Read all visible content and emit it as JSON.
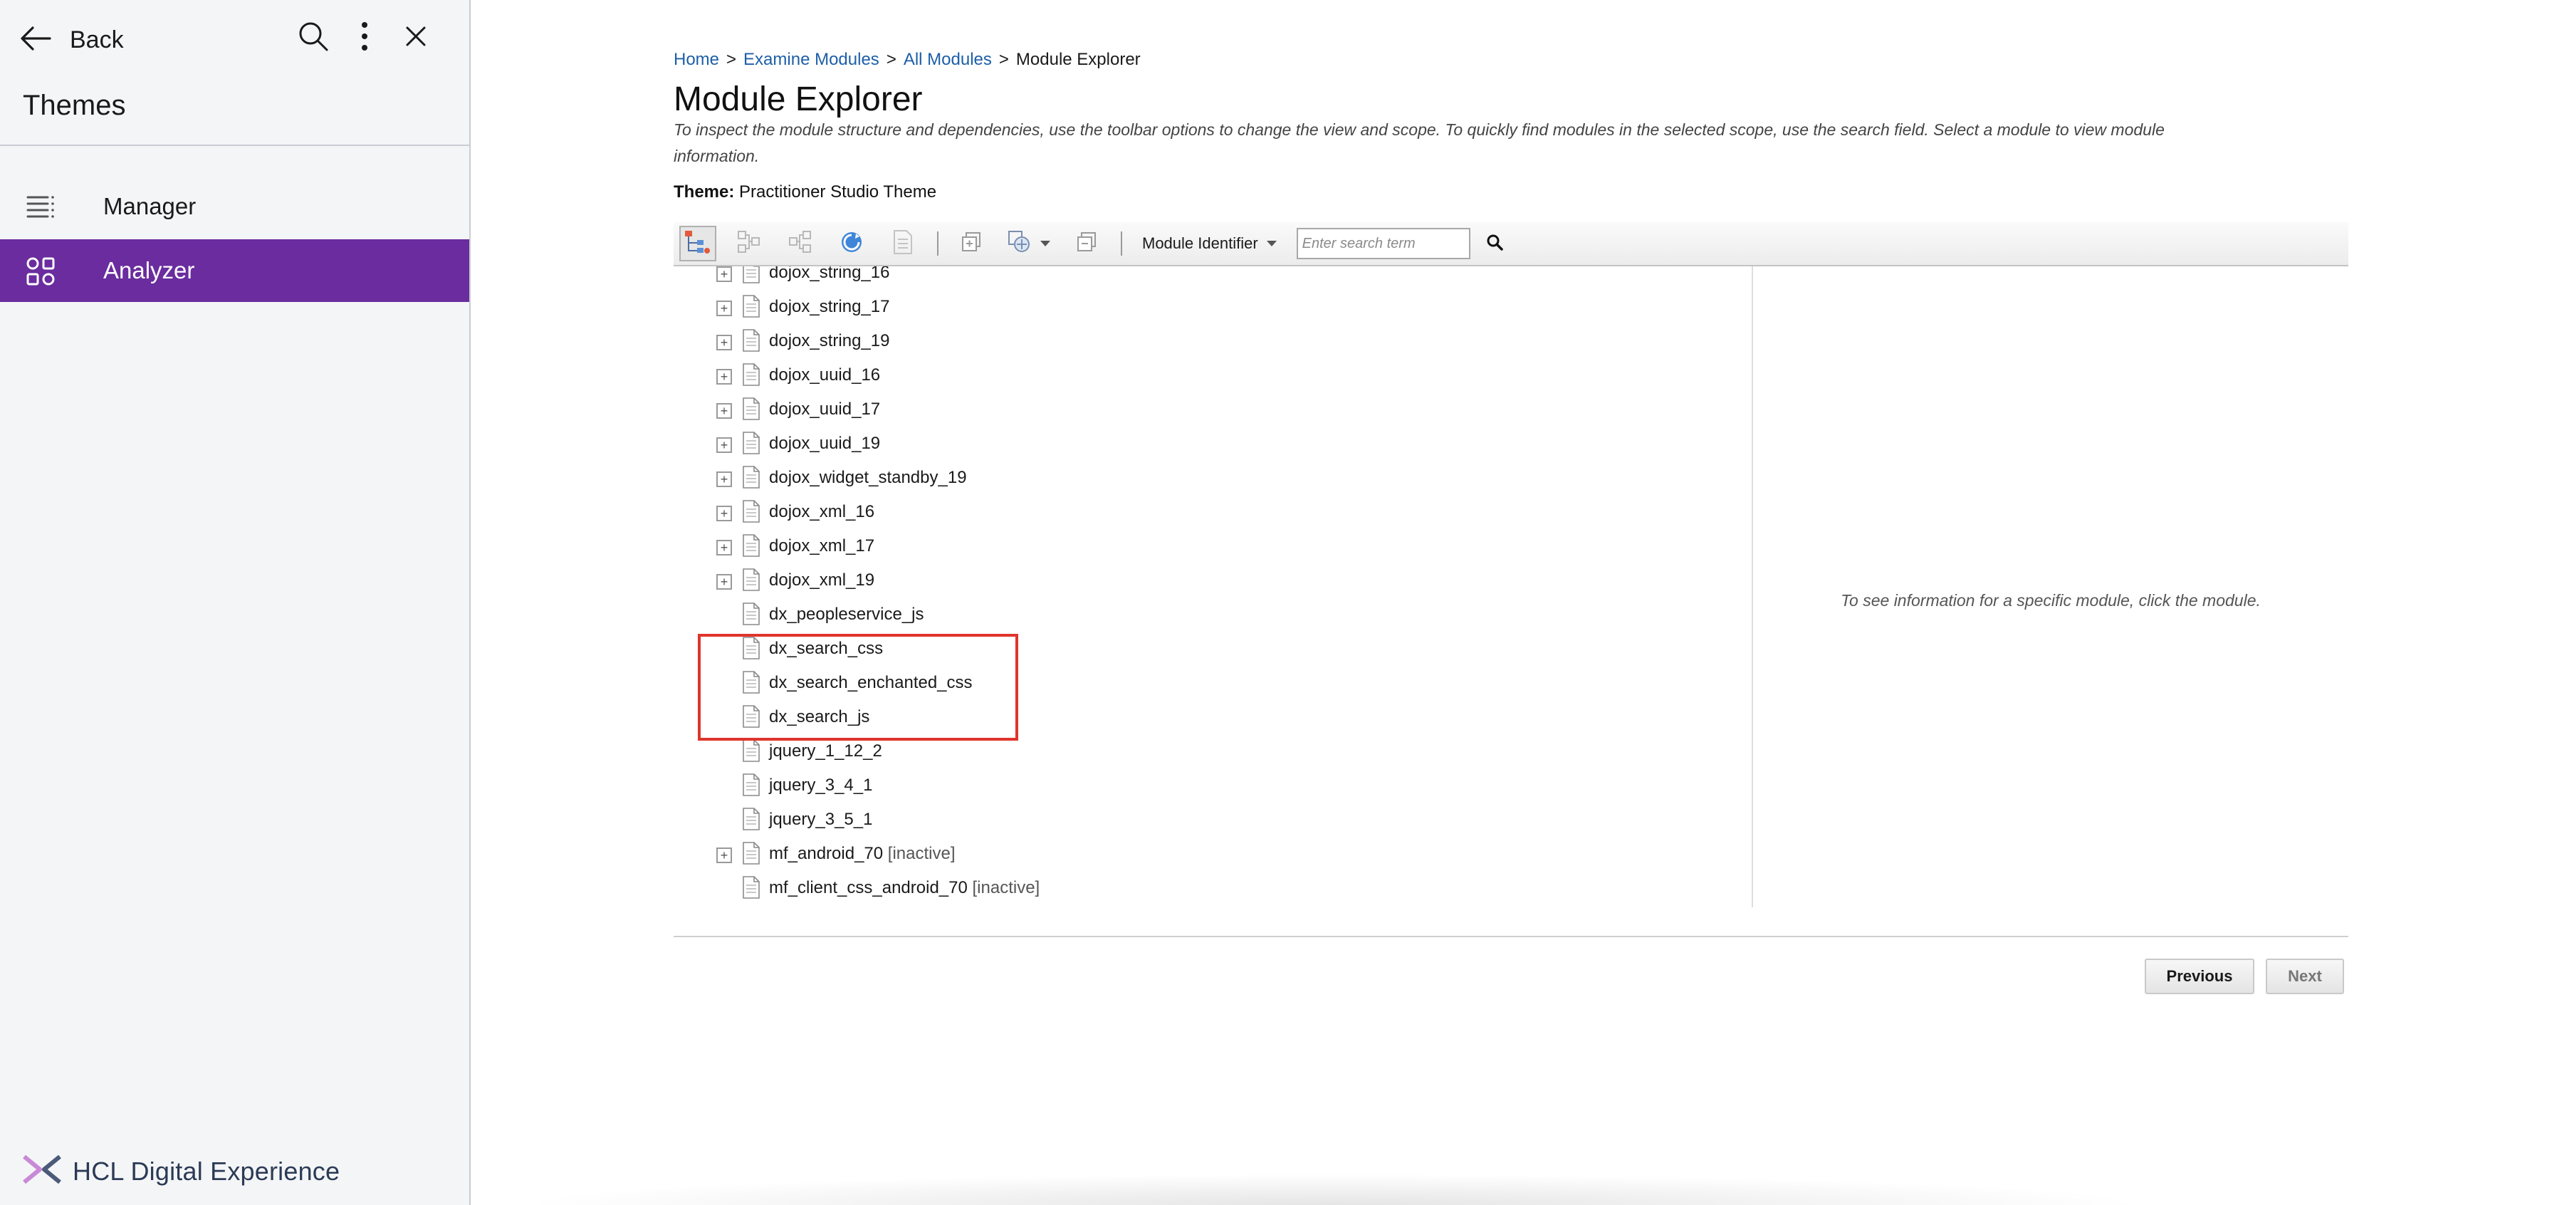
{
  "sidebar": {
    "back_label": "Back",
    "title": "Themes",
    "actions": [
      "search-icon",
      "more-vertical-icon",
      "close-icon"
    ],
    "items": [
      {
        "label": "Manager",
        "icon": "list-icon",
        "selected": false
      },
      {
        "label": "Analyzer",
        "icon": "modules-icon",
        "selected": true
      }
    ],
    "brand": "HCL Digital Experience",
    "selected_color": "#6a2c9e"
  },
  "main": {
    "breadcrumb": {
      "home": "Home",
      "examine": "Examine Modules",
      "all": "All Modules",
      "current": "Module Explorer",
      "separator": ">"
    },
    "title": "Module Explorer",
    "description": "To inspect the module structure and dependencies, use the toolbar options to change the view and scope. To quickly find modules in the selected scope, use the search field. Select a module to view module information.",
    "theme_label": "Theme:",
    "theme_value": "Practitioner Studio Theme",
    "toolbar": {
      "dropdown_label": "Module Identifier",
      "search_placeholder": "Enter search term"
    },
    "tree": [
      {
        "label": "dojox_string_16",
        "expandable": true
      },
      {
        "label": "dojox_string_17",
        "expandable": true
      },
      {
        "label": "dojox_string_19",
        "expandable": true
      },
      {
        "label": "dojox_uuid_16",
        "expandable": true
      },
      {
        "label": "dojox_uuid_17",
        "expandable": true
      },
      {
        "label": "dojox_uuid_19",
        "expandable": true
      },
      {
        "label": "dojox_widget_standby_19",
        "expandable": true
      },
      {
        "label": "dojox_xml_16",
        "expandable": true
      },
      {
        "label": "dojox_xml_17",
        "expandable": true
      },
      {
        "label": "dojox_xml_19",
        "expandable": true
      },
      {
        "label": "dx_peopleservice_js",
        "expandable": false
      },
      {
        "label": "dx_search_css",
        "expandable": false
      },
      {
        "label": "dx_search_enchanted_css",
        "expandable": false
      },
      {
        "label": "dx_search_js",
        "expandable": false
      },
      {
        "label": "jquery_1_12_2",
        "expandable": false
      },
      {
        "label": "jquery_3_4_1",
        "expandable": false
      },
      {
        "label": "jquery_3_5_1",
        "expandable": false
      },
      {
        "label": "mf_android_70",
        "status": "[inactive]",
        "expandable": true
      },
      {
        "label": "mf_client_css_android_70",
        "status": "[inactive]",
        "expandable": false
      }
    ],
    "info_message": "To see information for a specific module, click the module.",
    "pager": {
      "previous": "Previous",
      "next": "Next"
    },
    "highlight_color": "#e0342c"
  }
}
